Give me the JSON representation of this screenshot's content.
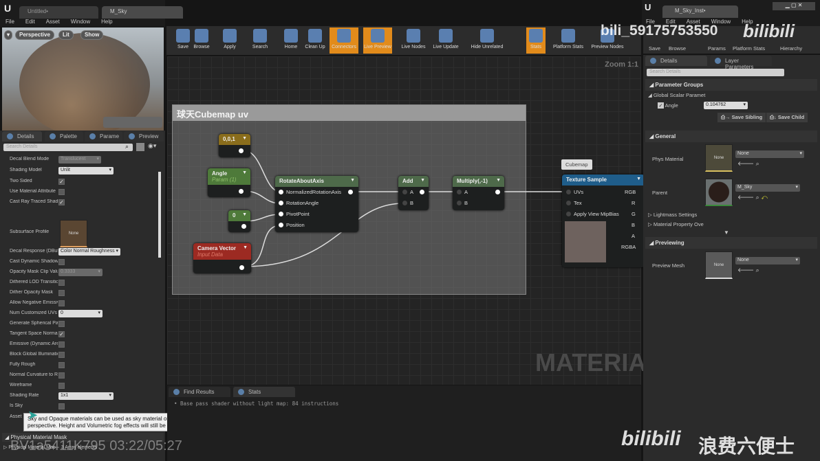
{
  "left": {
    "tabs": [
      "Untitled•",
      "M_Sky"
    ],
    "menu": [
      "File",
      "Edit",
      "Asset",
      "Window",
      "Help"
    ],
    "viewport": {
      "perspective": "Perspective",
      "lit": "Lit",
      "show": "Show"
    },
    "panel_tabs": [
      "Details",
      "Palette",
      "Parame",
      "Preview"
    ],
    "search_placeholder": "Search Details",
    "properties": [
      {
        "label": "Decal Blend Mode",
        "type": "dd-dis",
        "value": "Translucent"
      },
      {
        "label": "Shading Model",
        "type": "dd",
        "value": "Unlit"
      },
      {
        "label": "Two Sided",
        "type": "chk",
        "checked": true
      },
      {
        "label": "Use Material Attribute",
        "type": "chk",
        "checked": false
      },
      {
        "label": "Cast Ray Traced Shadows",
        "type": "chk",
        "checked": true
      },
      {
        "label": "Subsurface Profile",
        "type": "asset",
        "value": "None"
      },
      {
        "label": "Decal Response (DBuffer)",
        "type": "dd",
        "value": "Color Normal Roughness"
      },
      {
        "label": "Cast Dynamic Shadow",
        "type": "chk",
        "checked": false
      },
      {
        "label": "Opacity Mask Clip Value",
        "type": "num-dis",
        "value": "0.3333"
      },
      {
        "label": "Dithered LOD Transition",
        "type": "chk",
        "checked": false
      },
      {
        "label": "Dither Opacity Mask",
        "type": "chk",
        "checked": false
      },
      {
        "label": "Allow Negative Emissive",
        "type": "chk",
        "checked": false
      },
      {
        "label": "Num Customized UVs",
        "type": "num",
        "value": "0"
      },
      {
        "label": "Generate Spherical Particle",
        "type": "chk",
        "checked": false
      },
      {
        "label": "Tangent Space Normal",
        "type": "chk",
        "checked": true
      },
      {
        "label": "Emissive (Dynamic Area)",
        "type": "chk",
        "checked": false
      },
      {
        "label": "Block Global Illumination",
        "type": "chk",
        "checked": false
      },
      {
        "label": "Fully Rough",
        "type": "chk",
        "checked": false
      },
      {
        "label": "Normal Curvature to Roughness",
        "type": "chk",
        "checked": false
      },
      {
        "label": "Wireframe",
        "type": "chk",
        "checked": false
      },
      {
        "label": "Shading Rate",
        "type": "dd",
        "value": "1x1"
      },
      {
        "label": "Is Sky",
        "type": "chk",
        "checked": false
      },
      {
        "label": "Asset",
        "type": "none"
      }
    ],
    "section_physical": "Physical Material Mask",
    "physical_map": "Physical Material Map",
    "physical_map_value": "3 Array elements",
    "tooltip": "Sky and Opaque materials can be used as sky material on a sky dome mesh. When IsSky is true, these meshes will not receive any contribution from the aerial perspective. Height and Volumetric fog effects will still be applied."
  },
  "toolbar": [
    "Save",
    "Browse",
    "Apply",
    "Search",
    "Home",
    "Clean Up",
    "Connectors",
    "Live Preview",
    "Live Nodes",
    "Live Update",
    "Hide Unrelated",
    "Stats",
    "Platform Stats",
    "Preview Nodes"
  ],
  "graph": {
    "zoom": "Zoom 1:1",
    "comment": "球天Cubemap uv",
    "watermark": "MATERIAL",
    "nodes": {
      "const3": "0,0,1",
      "angle": "Angle",
      "angle_sub": "Param (1)",
      "zero": "0",
      "camera": "Camera Vector",
      "camera_sub": "Input Data",
      "rotate": "RotateAboutAxis",
      "rotate_pins": [
        "NormalizedRotationAxis",
        "RotationAngle",
        "PivotPoint",
        "Position"
      ],
      "add": "Add",
      "multiply": "Multiply(,-1)",
      "texture": "Texture Sample",
      "cubemap_tag": "Cubemap",
      "tex_inputs": [
        "UVs",
        "Tex",
        "Apply View MipBias"
      ],
      "tex_outputs": [
        "RGB",
        "R",
        "G",
        "B",
        "A",
        "RGBA"
      ]
    }
  },
  "bottom": {
    "tabs": [
      "Find Results",
      "Stats"
    ],
    "lines": [
      "Base pass shader without light map: 84 instructions"
    ]
  },
  "right": {
    "tab": "M_Sky_Inst•",
    "menu": [
      "File",
      "Edit",
      "Asset",
      "Window",
      "Help"
    ],
    "toolbar": [
      "Save",
      "Browse",
      "Params",
      "Platform Stats",
      "Hierarchy"
    ],
    "panel_tabs": [
      "Details",
      "Layer Parameters"
    ],
    "search_placeholder": "Search Details",
    "param_groups": "Parameter Groups",
    "global_scalar": "Global Scalar Paramet",
    "angle_label": "Angle",
    "angle_value": "0.104762",
    "save_sibling": "Save Sibling",
    "save_child": "Save Child",
    "general": "General",
    "phys_material": "Phys Material",
    "phys_value": "None",
    "parent": "Parent",
    "parent_value": "M_Sky",
    "lightmass": "Lightmass Settings",
    "material_property": "Material Property Ove",
    "previewing": "Previewing",
    "preview_mesh": "Preview Mesh",
    "preview_value": "None",
    "none": "None"
  },
  "overlay": {
    "uploader": "bili_59175753550",
    "video_id": "BV1a5411K795",
    "time": "03:22/05:27",
    "brand": "bilibili",
    "channel": "浪费六便士"
  }
}
